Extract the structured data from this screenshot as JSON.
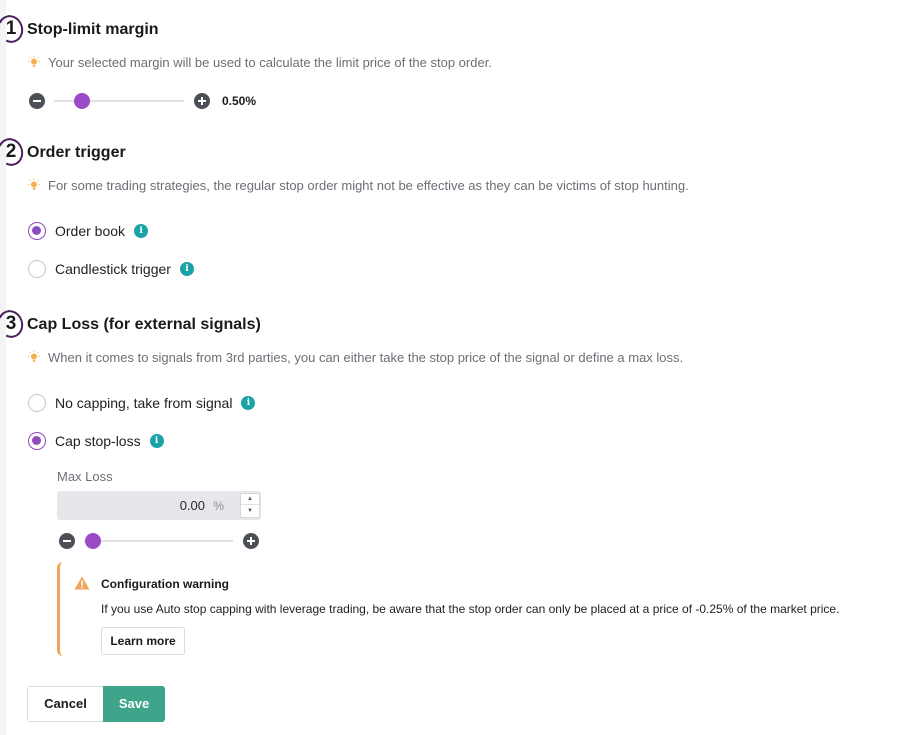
{
  "stop_limit": {
    "number": "1",
    "title": "Stop-limit margin",
    "hint": "Your selected margin will be used to calculate the limit price of the stop order.",
    "slider_value_text": "0.50%",
    "slider_fraction": 0.14
  },
  "order_trigger": {
    "number": "2",
    "title": "Order trigger",
    "hint": "For some trading strategies, the regular stop order might not be effective as they can be victims of stop hunting.",
    "options": [
      {
        "label": "Order book",
        "checked": true
      },
      {
        "label": "Candlestick trigger",
        "checked": false
      }
    ]
  },
  "cap_loss": {
    "number": "3",
    "title": "Cap Loss (for external signals)",
    "hint": "When it comes to signals from 3rd parties, you can either take the stop price of the signal or define a max loss.",
    "options": [
      {
        "label": "No capping, take from signal",
        "checked": false
      },
      {
        "label": "Cap stop-loss",
        "checked": true
      }
    ],
    "max_loss_label": "Max Loss",
    "max_loss_value": "0.00",
    "max_loss_unit": "%",
    "slider_fraction": 0.0
  },
  "warning": {
    "title": "Configuration warning",
    "body": "If you use Auto stop capping with leverage trading, be aware that the stop order can only be placed at a price of -0.25% of the market price.",
    "learn_more": "Learn more"
  },
  "actions": {
    "cancel": "Cancel",
    "save": "Save"
  },
  "colors": {
    "accent_purple": "#9a4cc7",
    "info_teal": "#1aa3a6",
    "save_green": "#3fa58a",
    "warning_orange": "#f0a65a",
    "step_ring": "#4a1f5c"
  },
  "icons": {
    "hint": "lightbulb-icon",
    "minus": "minus-circle-icon",
    "plus": "plus-circle-icon",
    "info": "info-icon",
    "warning": "warning-triangle-icon"
  }
}
